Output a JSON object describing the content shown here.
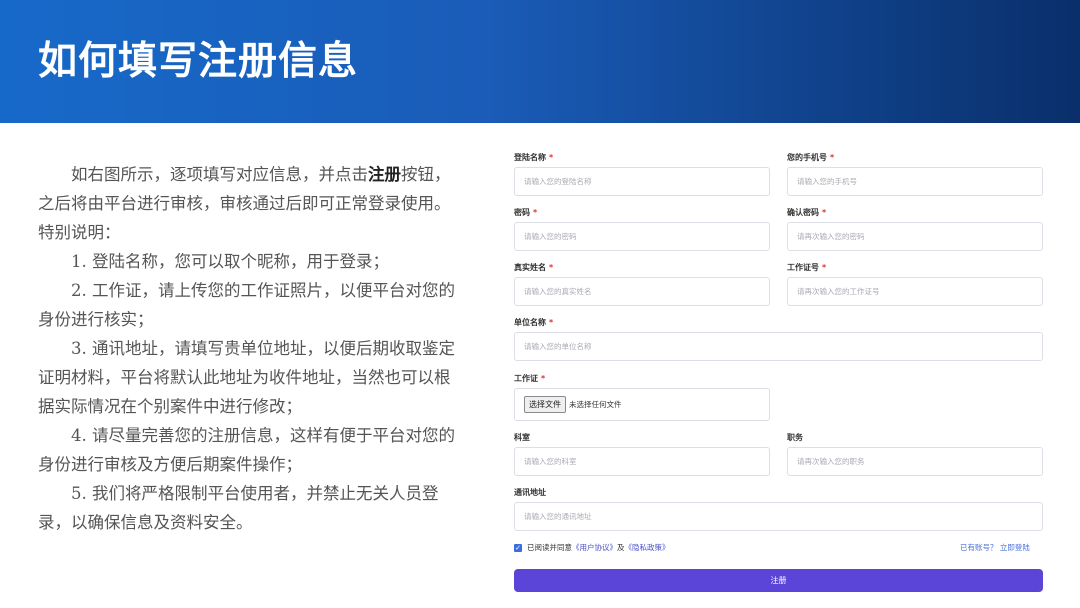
{
  "banner": {
    "title": "如何填写注册信息"
  },
  "description": {
    "intro_prefix": "如右图所示，逐项填写对应信息，并点击",
    "intro_highlight": "注册",
    "intro_suffix": "按钮，之后将由平台进行审核，审核通过后即可正常登录使用。特别说明：",
    "items": [
      "1. 登陆名称，您可以取个昵称，用于登录；",
      "2. 工作证，请上传您的工作证照片，以便平台对您的身份进行核实；",
      "3. 通讯地址，请填写贵单位地址，以便后期收取鉴定证明材料，平台将默认此地址为收件地址，当然也可以根据实际情况在个别案件中进行修改；",
      "4. 请尽量完善您的注册信息，这样有便于平台对您的身份进行审核及方便后期案件操作；",
      "5. 我们将严格限制平台使用者，并禁止无关人员登录，以确保信息及资料安全。"
    ]
  },
  "form": {
    "login_name": {
      "label": "登陆名称",
      "required": "*",
      "placeholder": "请输入您的登陆名称"
    },
    "phone": {
      "label": "您的手机号",
      "required": "*",
      "placeholder": "请输入您的手机号"
    },
    "password": {
      "label": "密码",
      "required": "*",
      "placeholder": "请输入您的密码"
    },
    "confirm_password": {
      "label": "确认密码",
      "required": "*",
      "placeholder": "请再次输入您的密码"
    },
    "real_name": {
      "label": "真实姓名",
      "required": "*",
      "placeholder": "请输入您的真实姓名"
    },
    "work_id": {
      "label": "工作证号",
      "required": "*",
      "placeholder": "请再次输入您的工作证号"
    },
    "org_name": {
      "label": "单位名称",
      "required": "*",
      "placeholder": "请输入您的单位名称"
    },
    "work_cert": {
      "label": "工作证",
      "required": "*",
      "button": "选择文件",
      "status": "未选择任何文件"
    },
    "department": {
      "label": "科室",
      "placeholder": "请输入您的科室"
    },
    "position": {
      "label": "职务",
      "placeholder": "请再次输入您的职务"
    },
    "address": {
      "label": "通讯地址",
      "placeholder": "请输入您的通讯地址"
    },
    "agreement": {
      "check": "✓",
      "prefix": "已阅读并同意",
      "user_agreement": "《用户协议》",
      "and": "及",
      "privacy": "《隐私政策》"
    },
    "login_link": "已有账号？ 立即登陆",
    "submit": "注册"
  }
}
